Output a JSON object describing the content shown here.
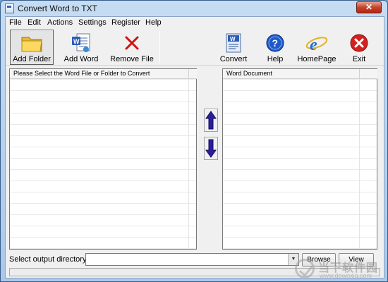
{
  "window": {
    "title": "Convert Word to TXT",
    "close_glyph": "✕"
  },
  "menu": [
    "File",
    "Edit",
    "Actions",
    "Settings",
    "Register",
    "Help"
  ],
  "toolbar": {
    "add_folder": "Add Folder",
    "add_word": "Add Word",
    "remove_file": "Remove File",
    "convert": "Convert",
    "help": "Help",
    "homepage": "HomePage",
    "exit": "Exit"
  },
  "left_panel": {
    "header": "Please Select the Word File or Folder to Convert"
  },
  "right_panel": {
    "header": "Word Document"
  },
  "output": {
    "label": "Select  output directory:",
    "value": "",
    "browse": "Browse",
    "view": "View"
  },
  "watermark": {
    "brand": "当下软件园",
    "url": "www.downxia.com"
  },
  "colors": {
    "arrow": "#2a1e9c",
    "remove_x": "#d01010",
    "exit_red": "#d42020",
    "help_blue": "#1f58c8",
    "ie_blue": "#1e6fd0"
  }
}
